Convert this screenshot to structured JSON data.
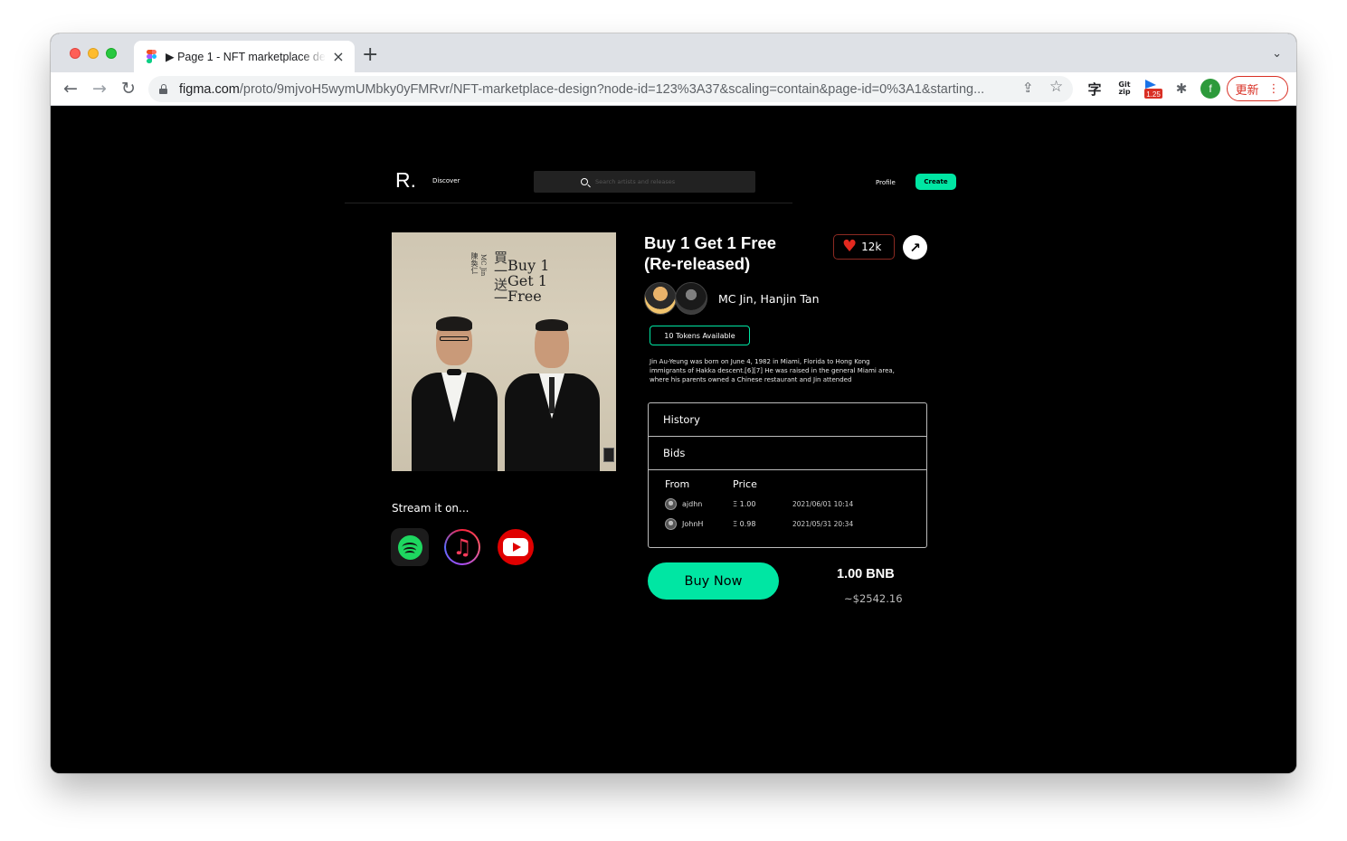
{
  "browser": {
    "tab_title": "▶ Page 1 - NFT marketplace design",
    "tab_close": "×",
    "new_tab": "+",
    "tab_menu": "⌄",
    "url_host": "figma.com",
    "url_path": "/proto/9mjvoH5wymUMbky0yFMRvr/NFT-marketplace-design?node-id=123%3A37&scaling=contain&page-id=0%3A1&starting...",
    "back": "←",
    "forward": "→",
    "reload": "↻",
    "share_icon": "⇪",
    "bookmark_icon": "☆",
    "ext_zi": "字",
    "ext_git_top": "Git",
    "ext_git_bottom": "zip",
    "ext_badge": "1.25",
    "ext_puzzle": "✱",
    "profile_initial": "f",
    "update_label": "更新",
    "update_menu": "⋮"
  },
  "header": {
    "logo": "R.",
    "discover": "Discover",
    "search_placeholder": "Search artists and releases",
    "profile": "Profile",
    "create": "Create"
  },
  "cover": {
    "title_line1": "Buy 1",
    "title_line2": "Get 1",
    "title_line3": "Free",
    "chinese_title": "買一送一",
    "artist_mc": "MC Jin",
    "artist_cn": "陳奐仁"
  },
  "stream": {
    "label": "Stream it on...",
    "services": [
      "Spotify",
      "Apple Music",
      "YouTube"
    ]
  },
  "release": {
    "title_line1": "Buy 1 Get 1 Free",
    "title_line2": "(Re-released)",
    "likes": "12k",
    "share_arrow": "↗",
    "artists": "MC Jin, Hanjin Tan",
    "tokens": "10 Tokens Available",
    "description": "Jin Au-Yeung was born on June 4, 1982 in Miami, Florida to Hong Kong immigrants of Hakka descent.[6][7] He was raised in the general Miami area, where his parents owned a Chinese restaurant and Jin attended"
  },
  "tabs": {
    "history": "History",
    "bids": "Bids",
    "columns": {
      "from": "From",
      "price": "Price"
    },
    "rows": [
      {
        "user": "ajdhn",
        "price": "Ξ 1.00",
        "date": "2021/06/01 10:14"
      },
      {
        "user": "JohnH",
        "price": "Ξ 0.98",
        "date": "2021/05/31 20:34"
      }
    ]
  },
  "purchase": {
    "buy_label": "Buy Now",
    "price_bnb": "1.00 BNB",
    "price_usd": "~$2542.16"
  },
  "colors": {
    "accent": "#00e6a3",
    "background": "#000000",
    "heart": "#e3291f"
  }
}
